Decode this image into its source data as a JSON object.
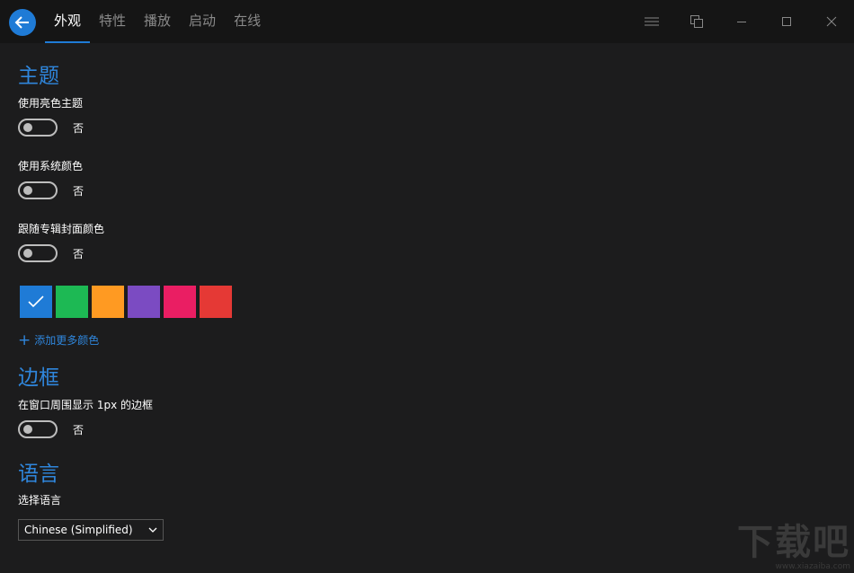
{
  "header": {
    "tabs": [
      {
        "label": "外观",
        "active": true
      },
      {
        "label": "特性",
        "active": false
      },
      {
        "label": "播放",
        "active": false
      },
      {
        "label": "启动",
        "active": false
      },
      {
        "label": "在线",
        "active": false
      }
    ]
  },
  "theme": {
    "title": "主题",
    "light_theme_label": "使用亮色主题",
    "light_theme_state": "否",
    "system_color_label": "使用系统颜色",
    "system_color_state": "否",
    "album_color_label": "跟随专辑封面颜色",
    "album_color_state": "否",
    "swatches": [
      "#1f7bd6",
      "#1db954",
      "#ff9a22",
      "#7b4bc2",
      "#ea1e63",
      "#e53935"
    ],
    "selected_swatch": 0,
    "add_color_label": "添加更多颜色"
  },
  "border": {
    "title": "边框",
    "label": "在窗口周围显示 1px 的边框",
    "state": "否"
  },
  "language": {
    "title": "语言",
    "label": "选择语言",
    "selected": "Chinese (Simplified)"
  },
  "watermark": {
    "big": "下载吧",
    "small": "www.xiazaiba.com"
  },
  "colors": {
    "accent": "#2f86dc",
    "background": "#1c1c1d",
    "titlebar": "#151515"
  }
}
